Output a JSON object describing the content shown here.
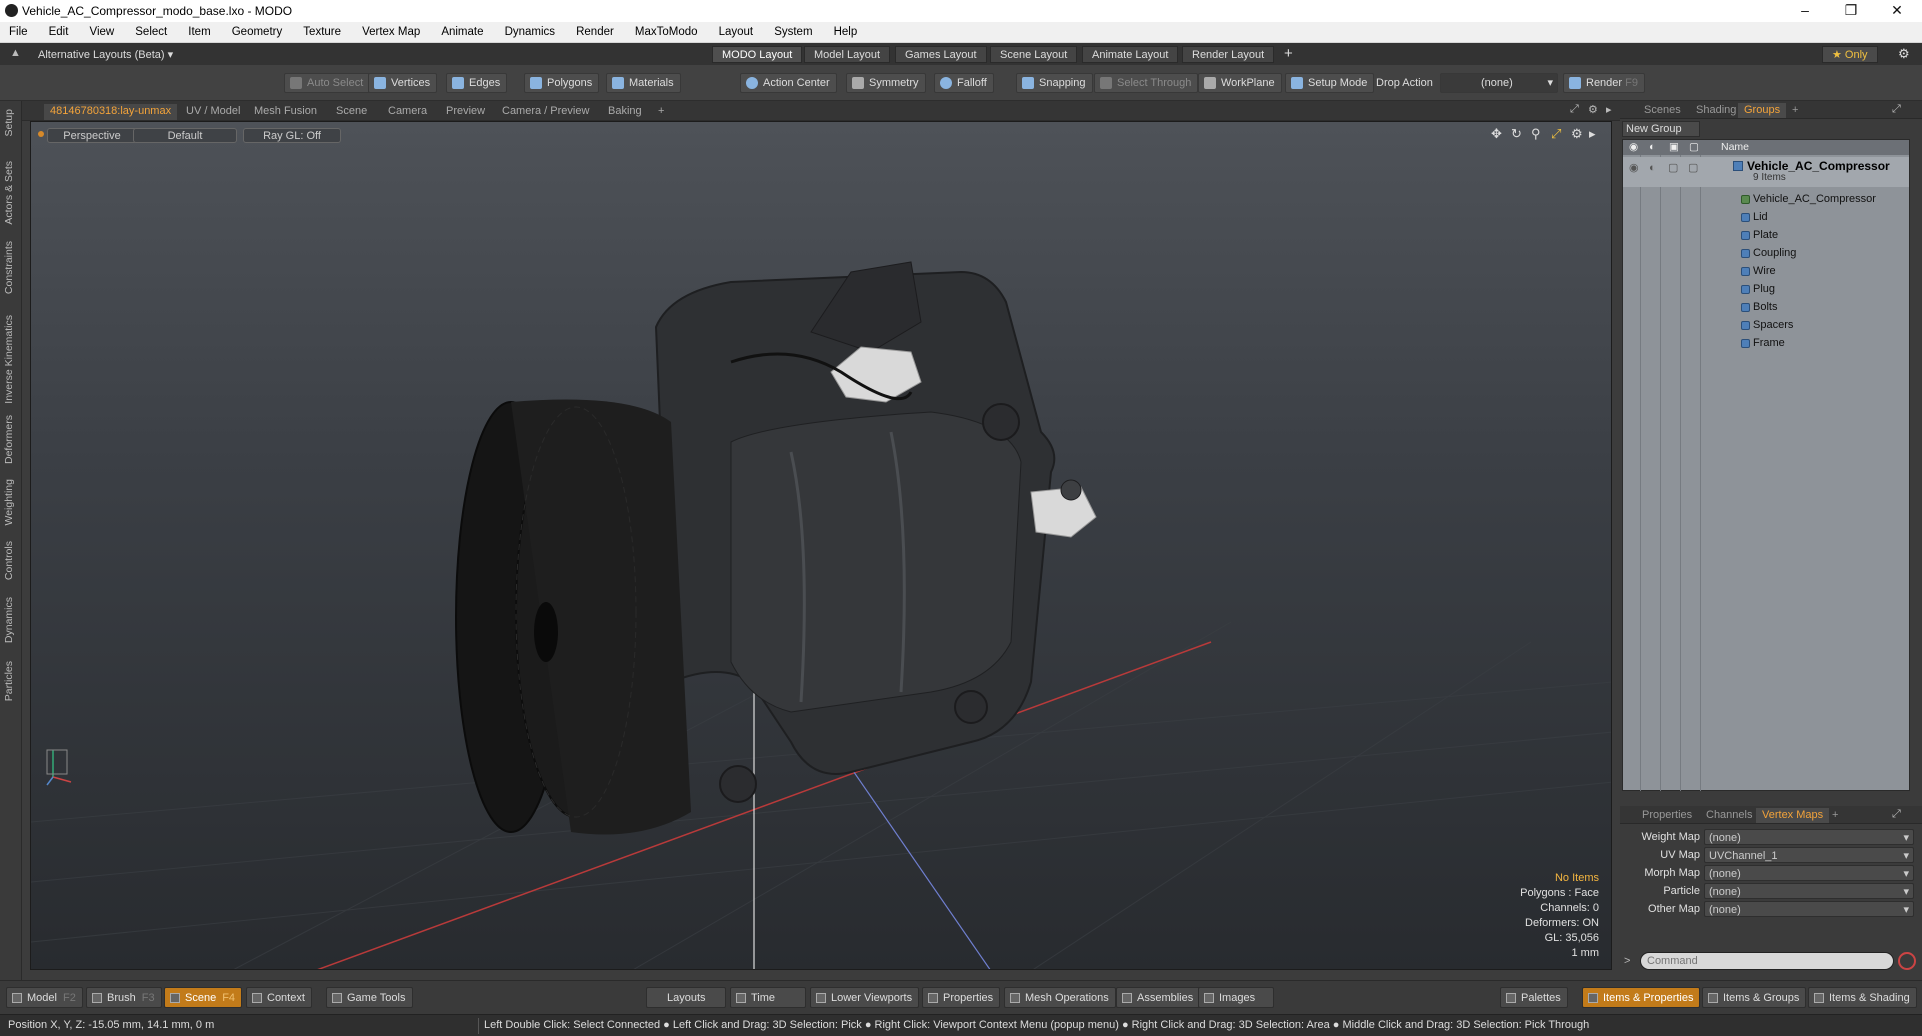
{
  "window": {
    "title": "Vehicle_AC_Compressor_modo_base.lxo - MODO",
    "minimize": "–",
    "restore": "❐",
    "close": "✕"
  },
  "menu": [
    "File",
    "Edit",
    "View",
    "Select",
    "Item",
    "Geometry",
    "Texture",
    "Vertex Map",
    "Animate",
    "Dynamics",
    "Render",
    "MaxToModo",
    "Layout",
    "System",
    "Help"
  ],
  "layouts": {
    "alt": "Alternative Layouts (Beta) ▾",
    "tabs": [
      "MODO Layout",
      "Model Layout",
      "Games Layout",
      "Scene Layout",
      "Animate Layout",
      "Render Layout"
    ],
    "add": "+",
    "only": "★ Only"
  },
  "toolbar": {
    "auto_select": "Auto Select",
    "vertices": "Vertices",
    "edges": "Edges",
    "polygons": "Polygons",
    "materials": "Materials",
    "action_center": "Action Center",
    "symmetry": "Symmetry",
    "falloff": "Falloff",
    "snapping": "Snapping",
    "select_through": "Select Through",
    "workplane": "WorkPlane",
    "setup_mode": "Setup Mode",
    "drop_action": "Drop Action",
    "drop_value": "(none)",
    "render": "Render",
    "render_key": "F9"
  },
  "left_tabs": [
    "Setup",
    "Actors & Sets",
    "Constraints",
    "Inverse Kinematics",
    "Deformers",
    "Weighting",
    "Controls",
    "Dynamics",
    "Particles"
  ],
  "viewport_tabs": [
    "48146780318:lay-unmax",
    "UV / Model",
    "Mesh Fusion",
    "Scene",
    "Camera",
    "Preview",
    "Camera / Preview",
    "Baking",
    "+"
  ],
  "viewport": {
    "perspective": "Perspective",
    "shading": "Default",
    "raygl": "Ray GL: Off",
    "hud": {
      "items": "No Items",
      "polygons": "Polygons : Face",
      "channels": "Channels: 0",
      "deformers": "Deformers: ON",
      "gl": "GL: 35,056",
      "scale": "1 mm"
    }
  },
  "scene_panel": {
    "tabs": [
      "Scenes",
      "Shading",
      "Groups",
      "+"
    ],
    "new_group": "New Group",
    "column_name": "Name",
    "root": {
      "name": "Vehicle_AC_Compressor",
      "count": "9 Items"
    },
    "items": [
      "Vehicle_AC_Compressor",
      "Lid",
      "Plate",
      "Coupling",
      "Wire",
      "Plug",
      "Bolts",
      "Spacers",
      "Frame"
    ]
  },
  "props_panel": {
    "tabs": [
      "Properties",
      "Channels",
      "Vertex Maps",
      "+"
    ],
    "rows": [
      {
        "label": "Weight Map",
        "value": "(none)"
      },
      {
        "label": "UV Map",
        "value": "UVChannel_1"
      },
      {
        "label": "Morph Map",
        "value": "(none)"
      },
      {
        "label": "Particle",
        "value": "(none)"
      },
      {
        "label": "Other Map",
        "value": "(none)"
      }
    ],
    "command_placeholder": "Command"
  },
  "bottom": {
    "model": "Model",
    "model_key": "F2",
    "brush": "Brush",
    "brush_key": "F3",
    "scene": "Scene",
    "scene_key": "F4",
    "context": "Context",
    "game_tools": "Game Tools",
    "layouts": "Layouts",
    "time": "Time",
    "lower_viewports": "Lower Viewports",
    "properties": "Properties",
    "mesh_operations": "Mesh Operations",
    "assemblies": "Assemblies",
    "images": "Images",
    "palettes": "Palettes",
    "items_properties": "Items & Properties",
    "items_groups": "Items & Groups",
    "items_shading": "Items & Shading"
  },
  "status": {
    "position": "Position X, Y, Z:  -15.05 mm, 14.1 mm, 0 m",
    "hints": "Left Double Click: Select Connected ● Left Click and Drag: 3D Selection: Pick ● Right Click: Viewport Context Menu (popup menu) ● Right Click and Drag: 3D Selection: Area ● Middle Click and Drag: 3D Selection: Pick Through"
  },
  "colors": {
    "accent": "#f3a33a",
    "active_button": "#c27b1a",
    "tree_bg": "#8e9399"
  }
}
